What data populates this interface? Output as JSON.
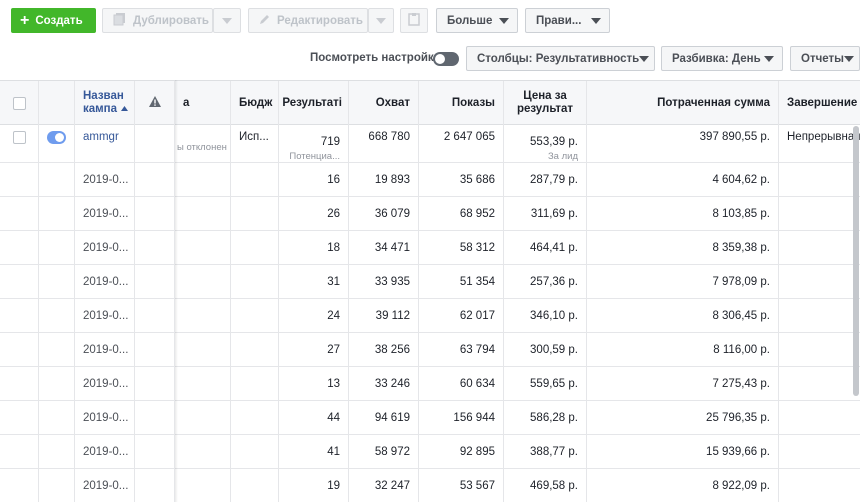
{
  "toolbar": {
    "create": "Создать",
    "duplicate": "Дублировать",
    "edit": "Редактировать",
    "more": "Больше",
    "rules": "Прави..."
  },
  "toolbar2": {
    "view_settings": "Посмотреть настройки",
    "columns": "Столбцы: Результативность",
    "breakdown": "Разбивка: День",
    "reports": "Отчеты"
  },
  "table": {
    "headers": {
      "name": "Назван кампа",
      "name_tail": "а",
      "budget": "Бюдж",
      "results": "Результаті",
      "reach": "Охват",
      "impressions": "Показы",
      "cost_per_result": "Цена за результат",
      "amount_spent": "Потраченная сумма",
      "ends": "Завершение"
    },
    "summary": {
      "name": "ammgr",
      "delivery_sub": "ы отклонен",
      "budget": "Исп...",
      "results": "719",
      "results_sub": "Потенциа...",
      "reach": "668 780",
      "impressions": "2 647 065",
      "cost_per_result": "553,39 р.",
      "cost_sub": "За лид",
      "amount_spent": "397 890,55 р.",
      "ends": "Непрерывная"
    },
    "rows": [
      {
        "date": "2019-0...",
        "results": "16",
        "reach": "19 893",
        "impressions": "35 686",
        "cost": "287,79 р.",
        "spent": "4 604,62 р."
      },
      {
        "date": "2019-0...",
        "results": "26",
        "reach": "36 079",
        "impressions": "68 952",
        "cost": "311,69 р.",
        "spent": "8 103,85 р."
      },
      {
        "date": "2019-0...",
        "results": "18",
        "reach": "34 471",
        "impressions": "58 312",
        "cost": "464,41 р.",
        "spent": "8 359,38 р."
      },
      {
        "date": "2019-0...",
        "results": "31",
        "reach": "33 935",
        "impressions": "51 354",
        "cost": "257,36 р.",
        "spent": "7 978,09 р."
      },
      {
        "date": "2019-0...",
        "results": "24",
        "reach": "39 112",
        "impressions": "62 017",
        "cost": "346,10 р.",
        "spent": "8 306,45 р."
      },
      {
        "date": "2019-0...",
        "results": "27",
        "reach": "38 256",
        "impressions": "63 794",
        "cost": "300,59 р.",
        "spent": "8 116,00 р."
      },
      {
        "date": "2019-0...",
        "results": "13",
        "reach": "33 246",
        "impressions": "60 634",
        "cost": "559,65 р.",
        "spent": "7 275,43 р."
      },
      {
        "date": "2019-0...",
        "results": "44",
        "reach": "94 619",
        "impressions": "156 944",
        "cost": "586,28 р.",
        "spent": "25 796,35 р."
      },
      {
        "date": "2019-0...",
        "results": "41",
        "reach": "58 972",
        "impressions": "92 895",
        "cost": "388,77 р.",
        "spent": "15 939,66 р."
      },
      {
        "date": "2019-0...",
        "results": "19",
        "reach": "32 247",
        "impressions": "53 567",
        "cost": "469,58 р.",
        "spent": "8 922,09 р."
      }
    ]
  },
  "colors": {
    "create_green": "#42b72a",
    "link_blue": "#365899",
    "toggle_on": "#6f9cee"
  },
  "icons": [
    "plus-icon",
    "duplicate-icon",
    "pencil-icon",
    "clipboard-icon",
    "warning-icon",
    "sort-ascending-icon",
    "chevron-down-icon"
  ]
}
